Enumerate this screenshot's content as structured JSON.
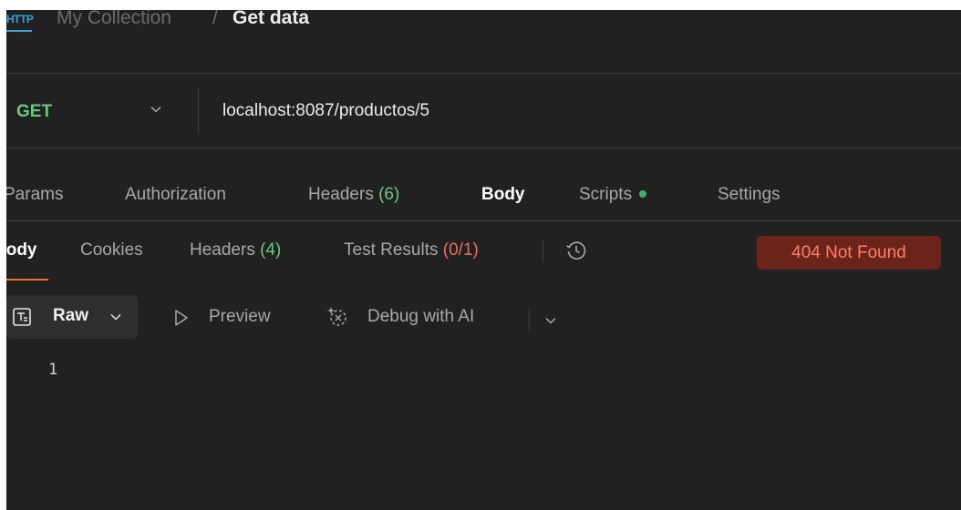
{
  "breadcrumb": {
    "icon": "http-icon",
    "icon_text": "HTTP",
    "collection": "My Collection",
    "separator": "/",
    "request_name": "Get data"
  },
  "request": {
    "method": "GET",
    "url": "localhost:8087/productos/5"
  },
  "request_tabs": {
    "params": "Params",
    "authorization": "Authorization",
    "headers_label": "Headers",
    "headers_count": "(6)",
    "body": "Body",
    "scripts": "Scripts",
    "settings": "Settings"
  },
  "response_tabs": {
    "body": "Body",
    "cookies": "Cookies",
    "headers_label": "Headers",
    "headers_count": "(4)",
    "tests_label": "Test Results",
    "tests_count": "(0/1)"
  },
  "status": "404 Not Found",
  "body_toolbar": {
    "format": "Raw",
    "preview": "Preview",
    "debug": "Debug with AI"
  },
  "editor": {
    "line_numbers": [
      "1"
    ]
  },
  "colors": {
    "background": "#212121",
    "method_green": "#6cc77e",
    "error_red": "#ef6e5a",
    "active_underline": "#ef6c2a",
    "badge_bg": "#6b2419"
  }
}
